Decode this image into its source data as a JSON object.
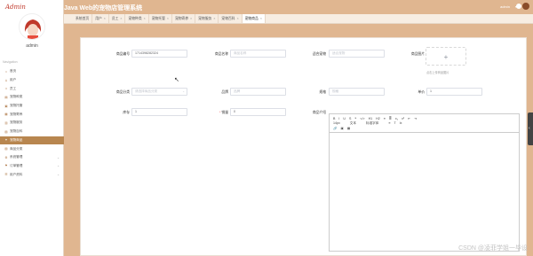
{
  "sidebar": {
    "logo": "Admin",
    "username": "admin",
    "nav_title": "Navigation",
    "items": [
      {
        "label": "首页",
        "icon": "home-icon",
        "glyph": "⌂",
        "has_children": false,
        "active": false
      },
      {
        "label": "用户",
        "icon": "user-icon",
        "glyph": "♙",
        "has_children": false,
        "active": false
      },
      {
        "label": "员工",
        "icon": "staff-icon",
        "glyph": "☺",
        "has_children": false,
        "active": false
      },
      {
        "label": "宠物种类",
        "icon": "category-icon",
        "glyph": "▤",
        "has_children": false,
        "active": false
      },
      {
        "label": "宠物托管",
        "icon": "hosting-icon",
        "glyph": "▣",
        "has_children": false,
        "active": false
      },
      {
        "label": "宠物寄养",
        "icon": "foster-icon",
        "glyph": "▦",
        "has_children": false,
        "active": false
      },
      {
        "label": "宠物服务",
        "icon": "service-icon",
        "glyph": "▥",
        "has_children": false,
        "active": false
      },
      {
        "label": "宠物百科",
        "icon": "wiki-icon",
        "glyph": "▧",
        "has_children": false,
        "active": false
      },
      {
        "label": "宠物商品",
        "icon": "goods-icon",
        "glyph": "✦",
        "has_children": false,
        "active": true
      },
      {
        "label": "商品分类",
        "icon": "goods-category-icon",
        "glyph": "▨",
        "has_children": false,
        "active": false
      },
      {
        "label": "系统管理",
        "icon": "system-icon",
        "glyph": "⚙",
        "has_children": true,
        "active": false
      },
      {
        "label": "订单管理",
        "icon": "order-icon",
        "glyph": "⚑",
        "has_children": true,
        "active": false
      },
      {
        "label": "用户资料",
        "icon": "profile-icon",
        "glyph": "☰",
        "has_children": true,
        "active": false
      }
    ]
  },
  "header": {
    "title": "Java Web的宠物店管理系统",
    "admin_label": "admin",
    "dropdown_glyph": "▾"
  },
  "tabs": [
    {
      "label": "系统首页",
      "active": false,
      "closable": false
    },
    {
      "label": "用户",
      "active": false,
      "closable": true
    },
    {
      "label": "员工",
      "active": false,
      "closable": true
    },
    {
      "label": "宠物种类",
      "active": false,
      "closable": true
    },
    {
      "label": "宠物托管",
      "active": false,
      "closable": true
    },
    {
      "label": "宠物寄养",
      "active": false,
      "closable": true
    },
    {
      "label": "宠物服务",
      "active": false,
      "closable": true
    },
    {
      "label": "宠物百科",
      "active": false,
      "closable": true
    },
    {
      "label": "宠物商品",
      "active": true,
      "closable": true
    }
  ],
  "form": {
    "code_label": "商品编号",
    "code_value": "1714398282324",
    "name_label": "商品名称",
    "name_placeholder": "商品名称",
    "origin_label": "适合宠物",
    "origin_placeholder": "适合宠物",
    "image_label": "商品图片",
    "upload_plus": "+",
    "upload_tip": "点击上传商品图片",
    "category_label": "商品分类",
    "category_placeholder": "请选择商品分类",
    "brand_label": "品牌",
    "brand_placeholder": "品牌",
    "spec_label": "规格",
    "spec_placeholder": "规格",
    "price_label": "单价",
    "price_value": "1",
    "stock_label": "库存",
    "stock_value": "1",
    "sales_label": "销量",
    "sales_value": "0",
    "intro_label": "商品介绍"
  },
  "editor": {
    "row1": [
      "B",
      "I",
      "U",
      "S",
      "❝",
      "</>",
      "H1",
      "H2",
      "≡",
      "≣",
      "x₂",
      "x²",
      "⇤",
      "⇥"
    ],
    "size": "14px",
    "font_label": "文本",
    "font_family": "标准字体",
    "row2_tail": [
      "≡",
      "T",
      "Ix"
    ],
    "row3": [
      "🔗",
      "▣",
      "▦"
    ]
  },
  "watermark": "CSDN @凌菲学姐一毕设",
  "side_handle_glyph": "‹"
}
